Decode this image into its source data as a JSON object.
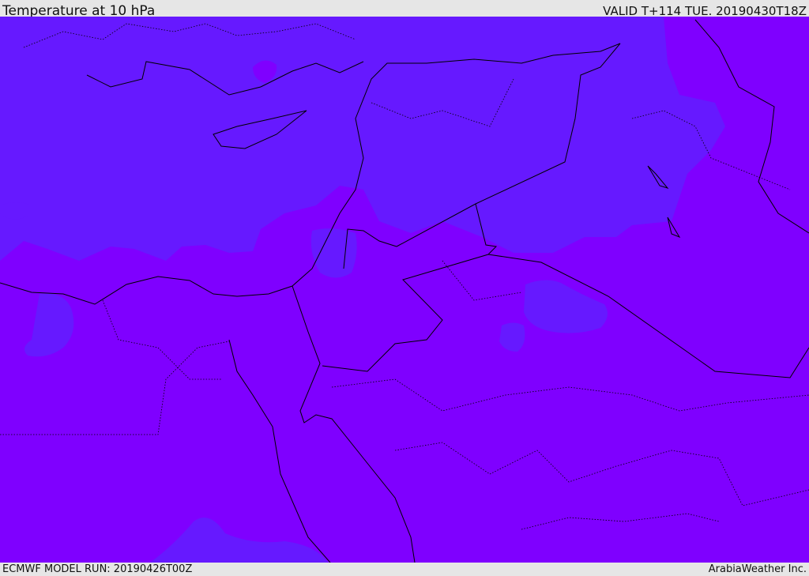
{
  "header": {
    "title": "Temperature at 10 hPa",
    "valid_time": "VALID T+114 TUE. 20190430T18Z"
  },
  "footer": {
    "model_run": "ECMWF MODEL RUN: 20190426T00Z",
    "brand": "ArabiaWeather Inc."
  },
  "colors": {
    "base_field": "#7f00ff",
    "cooler_field": "#6619ff",
    "border": "#000000",
    "bar_background": "#e6e6e6"
  }
}
